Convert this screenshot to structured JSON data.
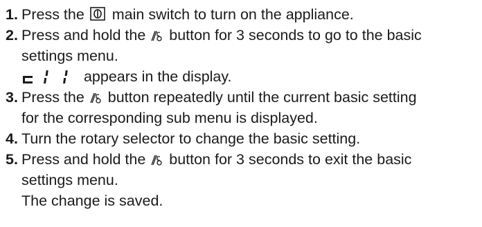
{
  "steps": [
    {
      "number": "1.",
      "icon": "power-switch-icon",
      "pre": "Press the ",
      "post": " main switch to turn on the appliance."
    },
    {
      "number": "2.",
      "icon": "settings-button-icon",
      "pre": "Press and hold the ",
      "post": " button for 3 seconds to go to the basic",
      "cont": "settings menu.",
      "sub": {
        "display_icon": "display-code-c11-icon",
        "text": " appears in the display."
      }
    },
    {
      "number": "3.",
      "icon": "settings-button-icon",
      "pre": "Press the ",
      "post": " button repeatedly until the current basic setting",
      "cont": "for the corresponding sub menu is displayed."
    },
    {
      "number": "4.",
      "text": "Turn the rotary selector to change the basic setting."
    },
    {
      "number": "5.",
      "icon": "settings-button-icon",
      "pre": "Press and hold the ",
      "post": " button for 3 seconds to exit the basic",
      "cont": "settings menu.",
      "result": "The change is saved."
    }
  ]
}
